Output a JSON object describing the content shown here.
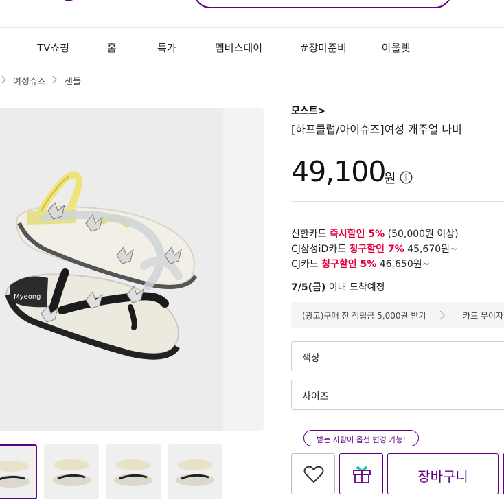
{
  "nav": {
    "items": [
      "TV쇼핑",
      "홈",
      "특가",
      "멤버스데이",
      "#장마준비",
      "아울렛"
    ]
  },
  "breadcrumb": [
    "여성슈즈",
    "샌들"
  ],
  "product": {
    "brand": "모스트",
    "brand_arrow": ">",
    "title": "[하프클럽/아이슈즈]여성 캐주얼 나비 ",
    "price": "49,100",
    "currency": "원"
  },
  "benefits": {
    "shinhan": {
      "prefix": "신한카드 ",
      "highlight": "즉시할인 5%",
      "suffix": " (50,000원 이상)"
    },
    "samsung": {
      "prefix": "CJ삼성iD카드 ",
      "highlight": "청구할인 7%",
      "suffix": " 45,670원~"
    },
    "cj": {
      "prefix": "CJ카드 ",
      "highlight": "청구할인 5%",
      "suffix": " 46,650원~"
    }
  },
  "delivery": {
    "date": "7/5(금)",
    "text": " 이내 도착예정"
  },
  "ad_banner": {
    "left": "(광고)구매 전 적립금 5,000원 받기",
    "right": "카드 무이자"
  },
  "options": {
    "color": "색상",
    "size": "사이즈"
  },
  "gift_tooltip": "받는 사람이 옵션 변경 가능!",
  "buttons": {
    "cart": "장바구니"
  },
  "colors": {
    "accent": "#5f0080",
    "discount": "#e0003c",
    "gift_icon_top": "#1ec6a1"
  },
  "image": {
    "watermark": "Myeong"
  }
}
